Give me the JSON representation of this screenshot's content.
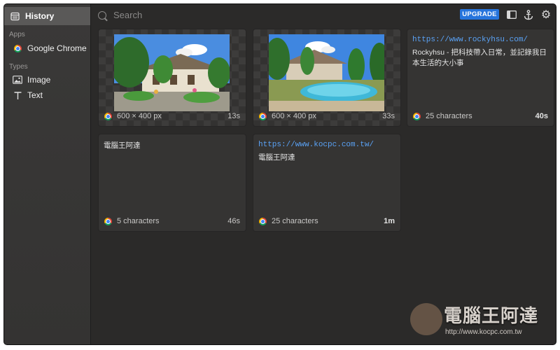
{
  "sidebar": {
    "history": "History",
    "apps_header": "Apps",
    "apps": [
      {
        "label": "Google Chrome"
      }
    ],
    "types_header": "Types",
    "types": [
      {
        "label": "Image"
      },
      {
        "label": "Text"
      }
    ]
  },
  "topbar": {
    "search_placeholder": "Search",
    "upgrade_label": "UPGRADE"
  },
  "cards": [
    {
      "kind": "image",
      "meta": "600 × 400 px",
      "age": "13s"
    },
    {
      "kind": "image",
      "meta": "600 × 400 px",
      "age": "33s"
    },
    {
      "kind": "text",
      "url": "https://www.rockyhsu.com/",
      "text": "Rockyhsu - 把科技帶入日常，並記錄我日本生活的大小事",
      "meta": "25 characters",
      "age": "40s"
    },
    {
      "kind": "text",
      "text": "電腦王阿達",
      "meta": "5 characters",
      "age": "46s"
    },
    {
      "kind": "text",
      "url": "https://www.kocpc.com.tw/",
      "text": "電腦王阿達",
      "meta": "25 characters",
      "age": "1m"
    }
  ],
  "watermark": {
    "title": "電腦王阿達",
    "url": "http://www.kocpc.com.tw"
  },
  "colors": {
    "accent": "#2674dc",
    "link": "#5aa2f5",
    "background": "#2b2a29",
    "sidebar": "#383736"
  },
  "icons": [
    "history-icon",
    "chrome-icon",
    "image-icon",
    "text-icon",
    "search-icon",
    "sidebar-toggle-icon",
    "anchor-icon",
    "gear-icon"
  ]
}
